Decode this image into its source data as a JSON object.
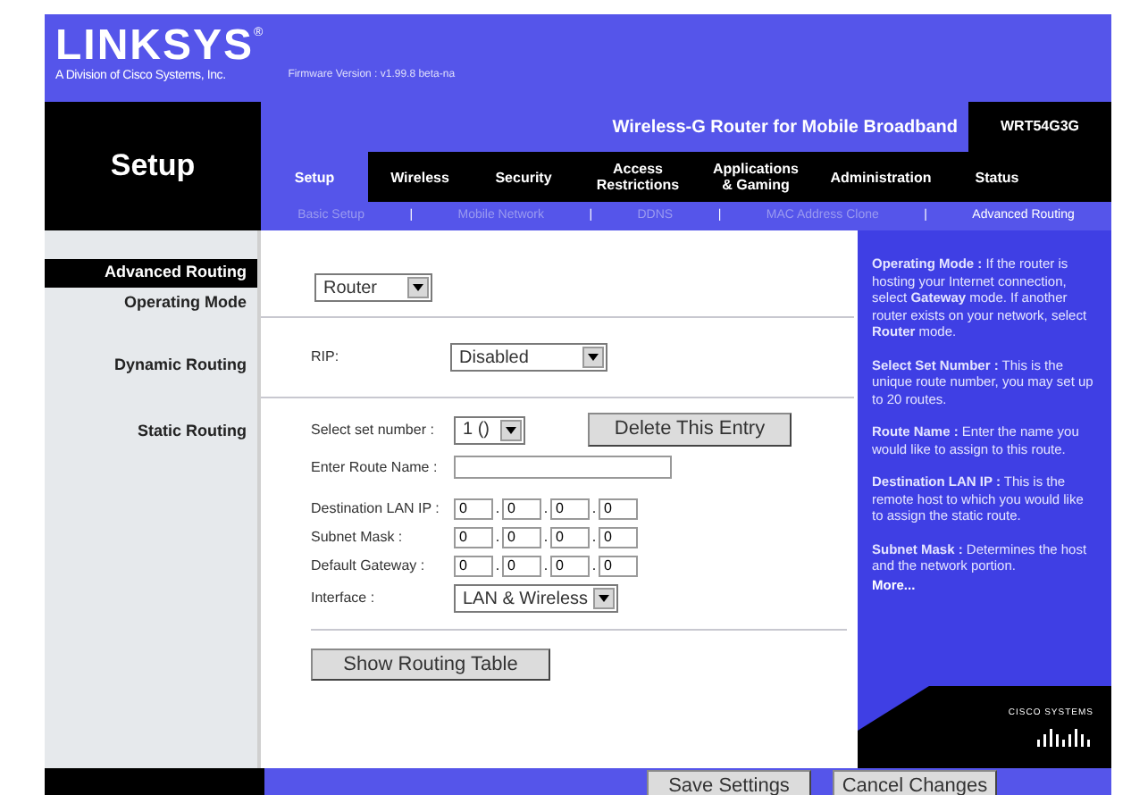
{
  "header": {
    "logo": "LINKSYS",
    "registered": "®",
    "division": "A Division of Cisco Systems, Inc.",
    "firmware": "Firmware Version : v1.99.8 beta-na"
  },
  "section_title": "Setup",
  "product_title": "Wireless-G Router for Mobile Broadband",
  "model": "WRT54G3G",
  "tabs": [
    {
      "label": "Setup",
      "selected": true
    },
    {
      "label": "Wireless",
      "selected": false
    },
    {
      "label": "Security",
      "selected": false
    },
    {
      "label": "Access Restrictions",
      "selected": false
    },
    {
      "label": "Applications & Gaming",
      "selected": false
    },
    {
      "label": "Administration",
      "selected": false
    },
    {
      "label": "Status",
      "selected": false
    }
  ],
  "subtabs": [
    {
      "label": "Basic Setup",
      "selected": false
    },
    {
      "label": "Mobile Network",
      "selected": false
    },
    {
      "label": "DDNS",
      "selected": false
    },
    {
      "label": "MAC Address Clone",
      "selected": false
    },
    {
      "label": "Advanced Routing",
      "selected": true
    }
  ],
  "subtab_separator": "|",
  "sidebar_heading": "Advanced Routing",
  "operating_mode": {
    "label": "Operating Mode",
    "value": "Router"
  },
  "dynamic_routing": {
    "label": "Dynamic Routing",
    "field_label": "RIP:",
    "value": "Disabled"
  },
  "static_routing": {
    "label": "Static Routing",
    "set_number": {
      "label": "Select set number :",
      "value": "1 ()"
    },
    "delete_button": "Delete This Entry",
    "route_name": {
      "label": "Enter Route Name :"
    },
    "ip_rows": [
      {
        "label": "Destination LAN IP :",
        "octets": [
          "0",
          "0",
          "0",
          "0"
        ]
      },
      {
        "label": "Subnet Mask :",
        "octets": [
          "0",
          "0",
          "0",
          "0"
        ]
      },
      {
        "label": "Default Gateway :",
        "octets": [
          "0",
          "0",
          "0",
          "0"
        ]
      }
    ],
    "ip_separator": ".",
    "interface": {
      "label": "Interface :",
      "value": "LAN & Wireless"
    },
    "show_table_button": "Show Routing Table"
  },
  "help": [
    "**Operating Mode :** If the router is hosting your Internet connection, select **Gateway** mode. If another router exists on your network, select **Router** mode.",
    "**Select Set Number :** This is the unique route number, you may set up to 20 routes.",
    "**Route Name :** Enter the name you would like to assign to this route.",
    "**Destination LAN IP :** This is the remote host to which you would like to assign the static route.",
    "**Subnet Mask :** Determines the host and the network portion."
  ],
  "help_more": "More...",
  "brand_mark": "CISCO SYSTEMS",
  "footer_buttons": [
    "Save Settings",
    "Cancel Changes"
  ]
}
